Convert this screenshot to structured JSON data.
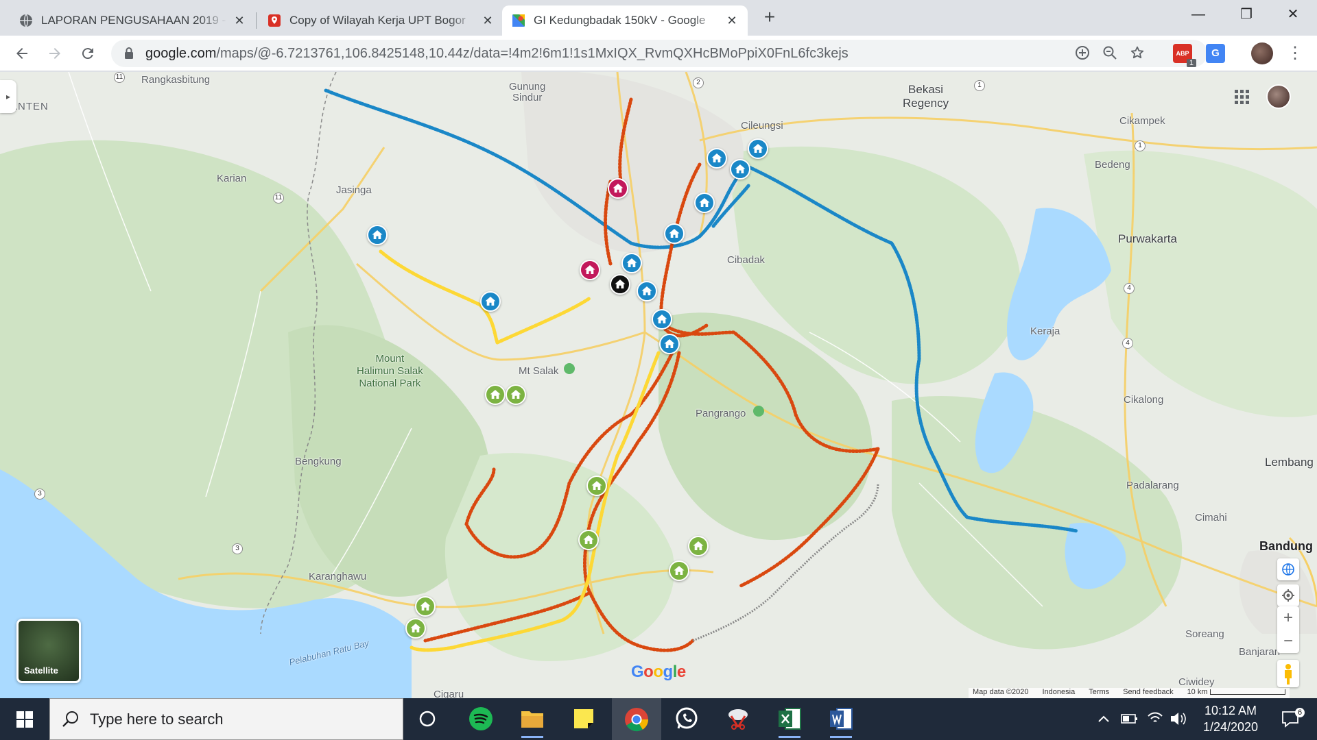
{
  "browser": {
    "tabs": [
      {
        "title": "LAPORAN PENGUSAHAAN 2019 -",
        "icon": "globe-icon",
        "active": false
      },
      {
        "title": "Copy of Wilayah Kerja UPT Bogor",
        "icon": "my-maps-icon",
        "active": false
      },
      {
        "title": "GI Kedungbadak 150kV - Google",
        "icon": "google-maps-icon",
        "active": true
      }
    ],
    "new_tab": "+",
    "window_controls": {
      "minimize": "—",
      "restore": "❐",
      "close": "✕"
    },
    "url_host": "google.com",
    "url_path": "/maps/@-6.7213761,106.8425148,10.44z/data=!4m2!6m1!1s1MxIQX_RvmQXHcBMoPpiX0FnL6fc3kejs",
    "ext_badge": "1"
  },
  "map": {
    "labels": {
      "banten": "BANTEN",
      "rangkasbitung": "Rangkasbitung",
      "gunung_sindur": "Gunung\nSindur",
      "bekasi": "Bekasi\nRegency",
      "cileungsi": "Cileungsi",
      "cikampek": "Cikampek",
      "bedeng": "Bedeng",
      "karian": "Karian",
      "jasinga": "Jasinga",
      "cibadak_n": "Cibadak",
      "purwakarta": "Purwakarta",
      "keraja": "Keraja",
      "mount_halimun": "Mount\nHalimun Salak\nNational Park",
      "mt_salak": "Mt Salak",
      "pangrango": "Pangrango",
      "cikalong": "Cikalong",
      "lembang": "Lembang",
      "bengkung": "Bengkung",
      "padalarang": "Padalarang",
      "cimahi": "Cimahi",
      "bandung": "Bandung",
      "karanghawu": "Karanghawu",
      "pelabuhan_ratu": "Pelabuhan Ratu Bay",
      "soreang": "Soreang",
      "banjaran": "Banjaran",
      "ciwidey": "Ciwidey",
      "cigaru": "Cigaru"
    },
    "road_shields": [
      "11",
      "11",
      "2",
      "1",
      "1",
      "4",
      "4",
      "3",
      "3"
    ],
    "satellite_label": "Satellite",
    "google_logo": "Google",
    "attribution": [
      "Map data ©2020",
      "Indonesia",
      "Terms",
      "Send feedback",
      "10 km"
    ],
    "colors": {
      "blue_line": "#1a87c7",
      "orange_line": "#e8590c",
      "yellow_line": "#fdd835",
      "blue_pin": "#1a87c7",
      "green_pin": "#7cb342",
      "red_pin": "#c2185b"
    }
  },
  "taskbar": {
    "search_placeholder": "Type here to search",
    "time": "10:12 AM",
    "date": "1/24/2020",
    "notification_count": "6"
  }
}
